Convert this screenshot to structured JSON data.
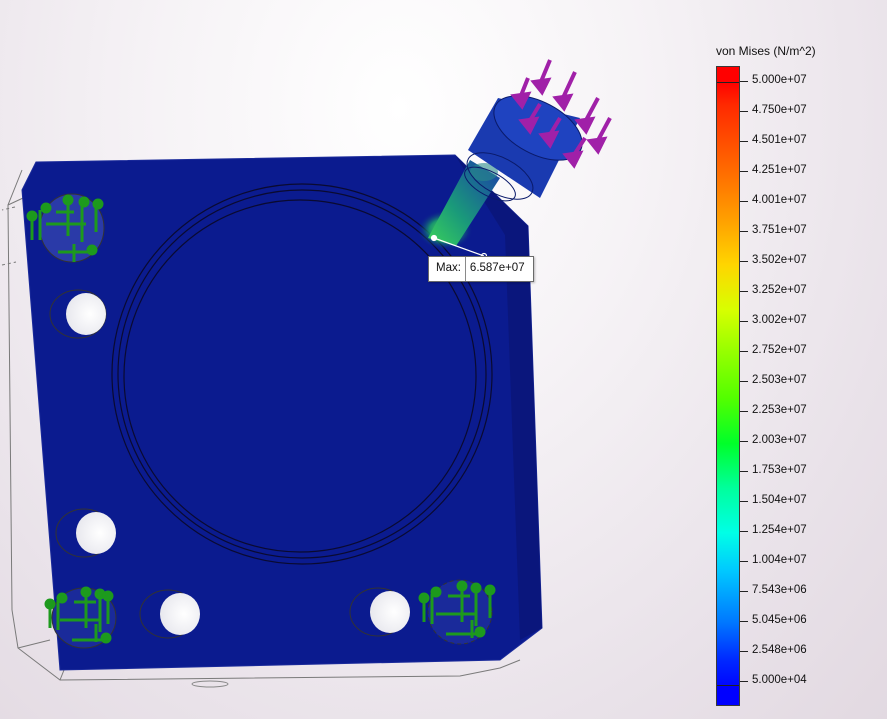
{
  "plot": {
    "quantity": "von Mises (N/m^2)",
    "colormap": "rainbow (blue-to-red)"
  },
  "legend": {
    "title": "von Mises (N/m^2)",
    "ticks": [
      "5.000e+07",
      "4.750e+07",
      "4.501e+07",
      "4.251e+07",
      "4.001e+07",
      "3.751e+07",
      "3.502e+07",
      "3.252e+07",
      "3.002e+07",
      "2.752e+07",
      "2.503e+07",
      "2.253e+07",
      "2.003e+07",
      "1.753e+07",
      "1.504e+07",
      "1.254e+07",
      "1.004e+07",
      "7.543e+06",
      "5.045e+06",
      "2.548e+06",
      "5.000e+04"
    ]
  },
  "probe": {
    "label": "Max:",
    "value": "6.587e+07"
  },
  "colors": {
    "part_body": "#0a1a8c",
    "fixture_arrows": "#1d9a1d",
    "load_arrows": "#a020a8",
    "max_red": "#ff0000",
    "min_blue": "#0000ff"
  }
}
